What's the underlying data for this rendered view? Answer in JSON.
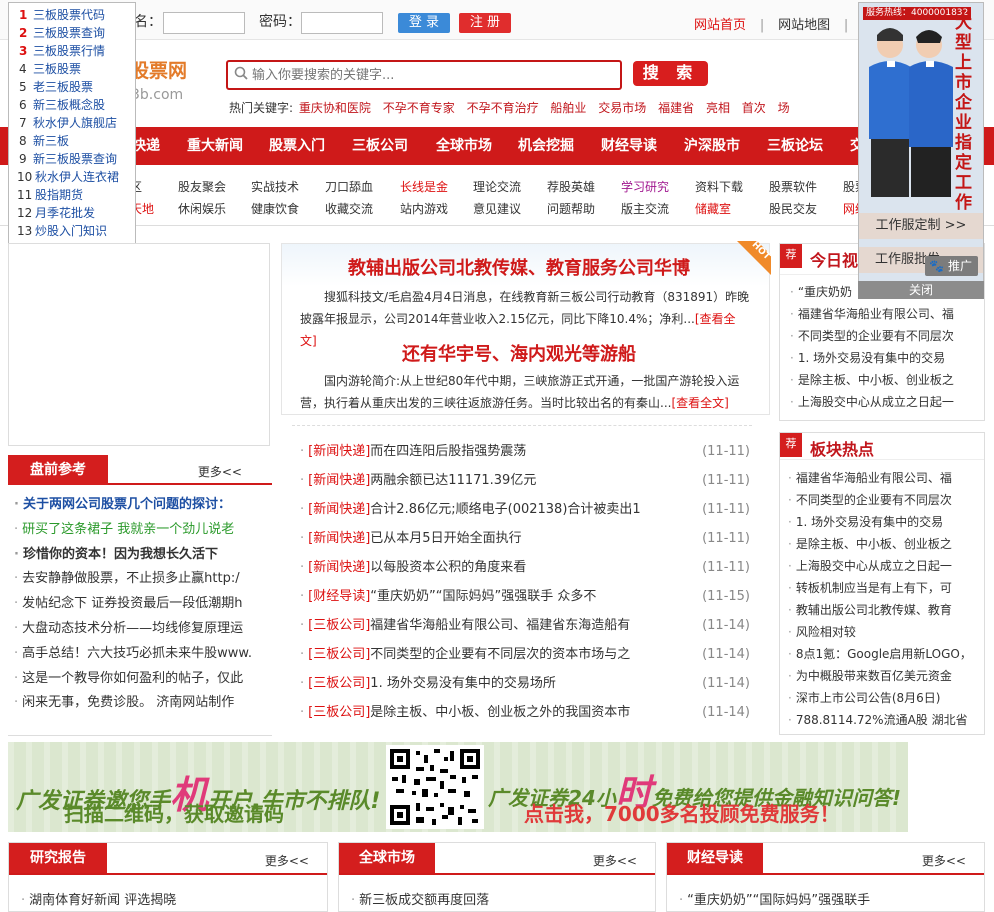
{
  "topbar": {
    "username_label": "名：",
    "password_label": "密码：",
    "login": "登 录",
    "register": "注 册",
    "home": "网站首页",
    "sitemap": "网站地图",
    "settings": "设",
    "sep": "|"
  },
  "header": {
    "logo_cn": "股票网",
    "logo_en": "3b.com",
    "search_placeholder": "输入你要搜索的关键字...",
    "search_btn": "搜 索",
    "hot_label": "热门关键字:",
    "hot_keywords": [
      "重庆协和医院",
      "不孕不育专家",
      "不孕不育治疗",
      "船舶业",
      "交易市场",
      "福建省",
      "亮相",
      "首次",
      "场"
    ]
  },
  "nav": [
    "快递",
    "重大新闻",
    "股票入门",
    "三板公司",
    "全球市场",
    "机会挖掘",
    "财经导读",
    "沪深股市",
    "三板论坛",
    "交"
  ],
  "subnav": {
    "row1": [
      "区",
      "股友聚会",
      "实战技术",
      "刀口舔血",
      "长线是金",
      "理论交流",
      "荐股英雄",
      "学习研究",
      "资料下载",
      "股票软件",
      "股票"
    ],
    "row2": [
      "天地",
      "休闲娱乐",
      "健康饮食",
      "收藏交流",
      "站内游戏",
      "意见建议",
      "问题帮助",
      "版主交流",
      "储藏室",
      "股民交友",
      "网络"
    ]
  },
  "leftfloat": {
    "items": [
      "三板股票代码",
      "三板股票查询",
      "三板股票行情",
      "三板股票",
      "老三板股票",
      "新三板概念股",
      "秋水伊人旗舰店",
      "新三板",
      "新三板股票查询",
      "秋水伊人连衣裙",
      "股指期货",
      "月季花批发",
      "炒股入门知识"
    ],
    "tuiguang": "推广",
    "close": "关闭"
  },
  "rightfloat": {
    "hotline": "服务热线：4000001832",
    "slogan": "大型上市企业指定工作",
    "btn1": "工作服定制 >>",
    "btn2": "工作服批发",
    "tuiguang": "推广",
    "close": "关闭"
  },
  "market": {
    "title": "盘前参考",
    "more": "更多<<",
    "items": [
      "关于两网公司股票几个问题的探讨：",
      "研买了这条裙子 我就亲一个劲儿说老",
      "珍惜你的资本！因为我想长久活下",
      "去安静静做股票，不止损多止赢http:/",
      "发帖纪念下 证券投资最后一段低潮期h",
      "大盘动态技术分析——均线修复原理运",
      "高手总结！六大技巧必抓未来牛股www.",
      "这是一个教导你如何盈利的帖子，仅此",
      "闲来无事，免费诊股。 济南网站制作"
    ]
  },
  "center": {
    "hot": "HOT",
    "headline1": "教辅出版公司北教传媒、教育服务公司华博",
    "summary1": "搜狐科技文/毛启盈4月4日消息，在线教育新三板公司行动教育（831891）昨晚披露年报显示，公司2014年营业收入2.15亿元，同比下降10.4%；净利...",
    "more1": "[查看全文]",
    "headline2": "还有华宇号、海内观光等游船",
    "summary2": "国内游轮简介:从上世纪80年代中期，三峡旅游正式开通，一批国产游轮投入运营，执行着从重庆出发的三峡往返旅游任务。当时比较出名的有秦山...",
    "more2": "[查看全文]",
    "news": [
      [
        "[新闻快递]",
        "而在四连阳后股指强势震荡",
        "(11-11)"
      ],
      [
        "[新闻快递]",
        "两融余额已达11171.39亿元",
        "(11-11)"
      ],
      [
        "[新闻快递]",
        "合计2.86亿元;顺络电子(002138)合计被卖出1",
        "(11-11)"
      ],
      [
        "[新闻快递]",
        "已从本月5日开始全面执行",
        "(11-11)"
      ],
      [
        "[新闻快递]",
        "以每股资本公积的角度来看",
        "(11-11)"
      ],
      [
        "[财经导读]",
        "“重庆奶奶”“国际妈妈”强强联手 众多不",
        "(11-15)"
      ],
      [
        "[三板公司]",
        "福建省华海船业有限公司、福建省东海造船有",
        "(11-14)"
      ],
      [
        "[三板公司]",
        "不同类型的企业要有不同层次的资本市场与之",
        "(11-14)"
      ],
      [
        "[三板公司]",
        "1. 场外交易没有集中的交易场所",
        "(11-14)"
      ],
      [
        "[三板公司]",
        "是除主板、中小板、创业板之外的我国资本市",
        "(11-14)"
      ]
    ]
  },
  "today": {
    "badge": "荐",
    "title": "今日视",
    "items": [
      "“重庆奶奶",
      "福建省华海船业有限公司、福",
      "不同类型的企业要有不同层次",
      "1. 场外交易没有集中的交易",
      "是除主板、中小板、创业板之",
      "上海股交中心从成立之日起一"
    ]
  },
  "sector": {
    "badge": "荐",
    "title": "板块热点",
    "items": [
      "福建省华海船业有限公司、福",
      "不同类型的企业要有不同层次",
      "1. 场外交易没有集中的交易",
      "是除主板、中小板、创业板之",
      "上海股交中心从成立之日起一",
      "转板机制应当是有上有下，可",
      "教辅出版公司北教传媒、教育",
      "风险相对较",
      "8点1氪：Google启用新LOGO，",
      "为中概股带来数百亿美元资金",
      "深市上市公司公告(8月6日)",
      "788.8114.72%流通A股 湖北省"
    ]
  },
  "banner": {
    "text1": "广发证券邀您手",
    "big1": "机",
    "text2": "开户,牛市不排队!",
    "sub1": "扫描二维码，获取邀请码",
    "text3": "广发证券24小",
    "big2": "时",
    "text4": "免费给您提供金融知识问答!",
    "sub2": "点击我，7000多名投顾免费服务！"
  },
  "bottom": {
    "col1": {
      "title": "研究报告",
      "more": "更多<<",
      "first": "湖南体育好新闻 评选揭晓"
    },
    "col2": {
      "title": "全球市场",
      "more": "更多<<",
      "first": "新三板成交额再度回落"
    },
    "col3": {
      "title": "财经导读",
      "more": "更多<<",
      "first": "“重庆奶奶”“国际妈妈”强强联手"
    }
  },
  "colors": {
    "brand_red": "#cf1a1a",
    "link_blue": "#1d4fa3",
    "hot_orange": "#f08a2a"
  }
}
